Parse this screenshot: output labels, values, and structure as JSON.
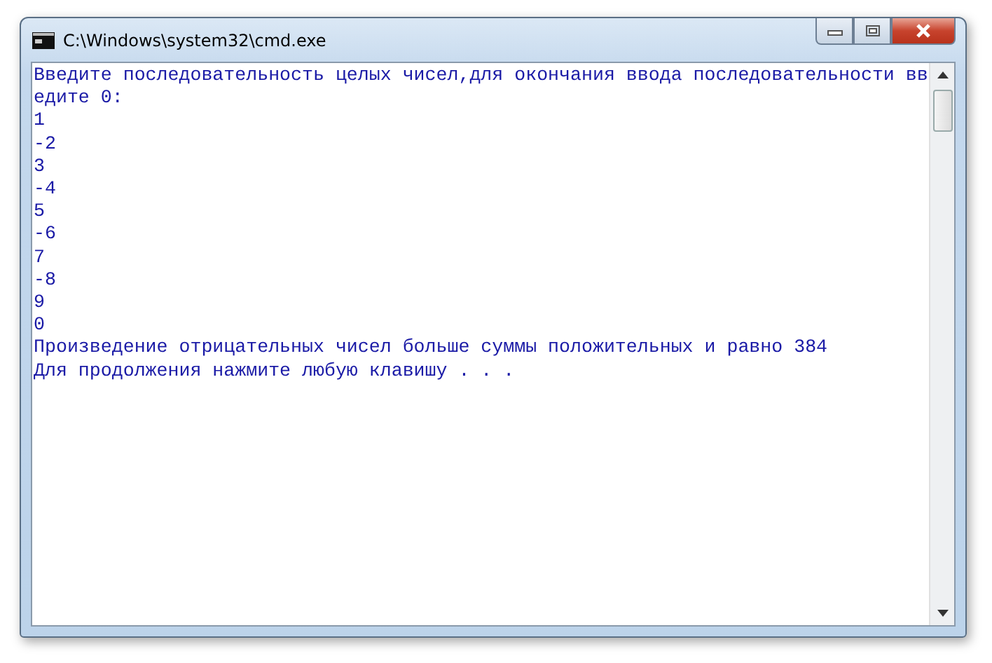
{
  "window": {
    "title": "C:\\Windows\\system32\\cmd.exe"
  },
  "console": {
    "lines": [
      "Введите последовательность целых чисел,для окончания ввода последовательности вв",
      "едите 0:",
      "1",
      "-2",
      "3",
      "-4",
      "5",
      "-6",
      "7",
      "-8",
      "9",
      "0",
      "Произведение отрицательных чисел больше суммы положительных и равно 384",
      "Для продолжения нажмите любую клавишу . . ."
    ]
  }
}
